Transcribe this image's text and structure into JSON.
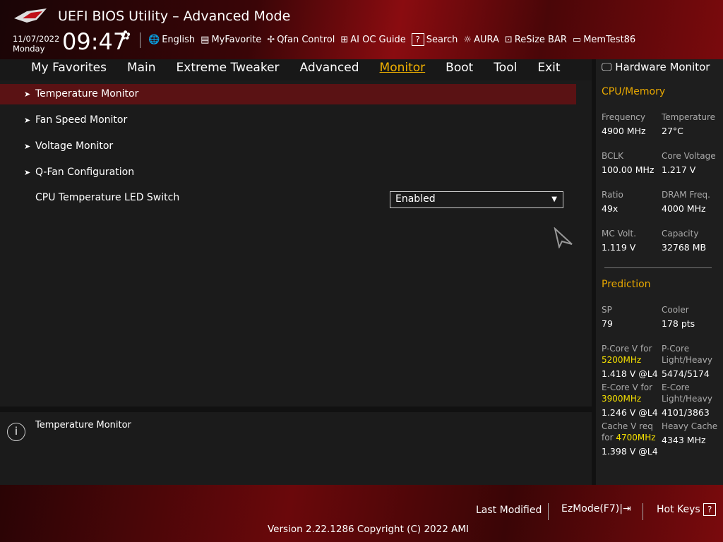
{
  "header": {
    "title": "UEFI BIOS Utility – Advanced Mode",
    "date": "11/07/2022",
    "day": "Monday",
    "time": "09:47",
    "tools": [
      {
        "icon": "globe-icon",
        "label": "English"
      },
      {
        "icon": "list-icon",
        "label": "MyFavorite"
      },
      {
        "icon": "fan-icon",
        "label": "Qfan Control"
      },
      {
        "icon": "chip-icon",
        "label": "AI OC Guide"
      },
      {
        "icon": "question-icon",
        "label": "Search"
      },
      {
        "icon": "aura-icon",
        "label": "AURA"
      },
      {
        "icon": "resize-icon",
        "label": "ReSize BAR"
      },
      {
        "icon": "memory-icon",
        "label": "MemTest86"
      }
    ]
  },
  "nav": [
    "My Favorites",
    "Main",
    "Extreme Tweaker",
    "Advanced",
    "Monitor",
    "Boot",
    "Tool",
    "Exit"
  ],
  "active_tab": "Monitor",
  "menu": [
    "Temperature Monitor",
    "Fan Speed Monitor",
    "Voltage Monitor",
    "Q-Fan Configuration"
  ],
  "led": {
    "label": "CPU Temperature LED Switch",
    "value": "Enabled"
  },
  "help": "Temperature Monitor",
  "hw": {
    "title": "Hardware Monitor",
    "cpu_title": "CPU/Memory",
    "cpu": [
      [
        "Frequency",
        "4900 MHz",
        "Temperature",
        "27°C"
      ],
      [
        "BCLK",
        "100.00 MHz",
        "Core Voltage",
        "1.217 V"
      ],
      [
        "Ratio",
        "49x",
        "DRAM Freq.",
        "4000 MHz"
      ],
      [
        "MC Volt.",
        "1.119 V",
        "Capacity",
        "32768 MB"
      ]
    ],
    "pred_title": "Prediction",
    "sp_label": "SP",
    "sp": "79",
    "cooler_label": "Cooler",
    "cooler": "178 pts",
    "pcore_l1": "P-Core V for",
    "pcore_f": "5200MHz",
    "pcore_v": "1.418 V @L4",
    "pcore_r1": "P-Core",
    "pcore_r2": "Light/Heavy",
    "pcore_rv": "5474/5174",
    "ecore_l1": "E-Core V for",
    "ecore_f": "3900MHz",
    "ecore_v": "1.246 V @L4",
    "ecore_r1": "E-Core",
    "ecore_r2": "Light/Heavy",
    "ecore_rv": "4101/3863",
    "cache_l1": "Cache V req",
    "cache_l2": "for",
    "cache_f": "4700MHz",
    "cache_v": "1.398 V @L4",
    "cache_r1": "Heavy Cache",
    "cache_rv": "4343 MHz"
  },
  "footer": {
    "last_modified": "Last Modified",
    "ezmode": "EzMode(F7)",
    "hotkeys": "Hot Keys",
    "version": "Version 2.22.1286 Copyright (C) 2022 AMI"
  }
}
